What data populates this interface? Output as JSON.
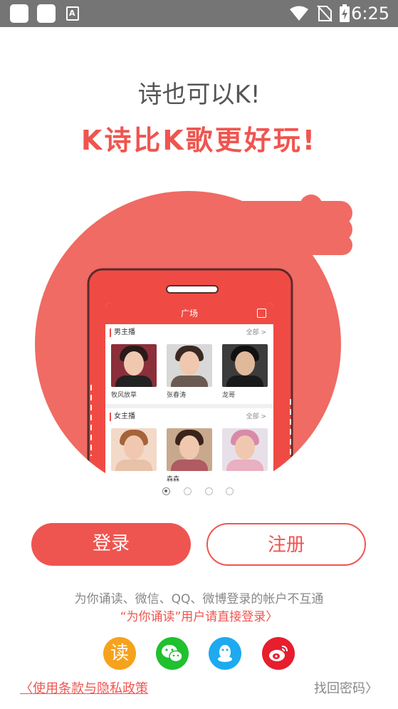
{
  "status_bar": {
    "time": "6:25",
    "notif_letter": "A"
  },
  "tagline": {
    "line1": "诗也可以K!",
    "line2": "K诗比K歌更好玩!"
  },
  "preview": {
    "header_title": "广场",
    "sections": [
      {
        "title": "男主播",
        "more": "全部 >",
        "people": [
          {
            "name": "牧风放草"
          },
          {
            "name": "张春涛"
          },
          {
            "name": "龙哥"
          }
        ]
      },
      {
        "title": "女主播",
        "more": "全部 >",
        "people": [
          {
            "name": ""
          },
          {
            "name": "森森"
          },
          {
            "name": ""
          }
        ]
      }
    ]
  },
  "carousel": {
    "pages": 4,
    "active": 1
  },
  "buttons": {
    "login": "登录",
    "register": "注册"
  },
  "notice": {
    "line1": "为你诵读、微信、QQ、微博登录的帐户不互通",
    "line2": "“为你诵读”用户请直接登录〉"
  },
  "social": [
    {
      "name": "read",
      "label": "读",
      "color": "#f6a21c"
    },
    {
      "name": "wechat",
      "color": "#1fc12e"
    },
    {
      "name": "qq",
      "color": "#1eaaf0"
    },
    {
      "name": "weibo",
      "color": "#e61e2e"
    }
  ],
  "footer": {
    "terms": "〈使用条款与隐私政策",
    "forgot": "找回密码〉"
  },
  "colors": {
    "accent": "#ef5550",
    "statusbar": "#757575"
  }
}
